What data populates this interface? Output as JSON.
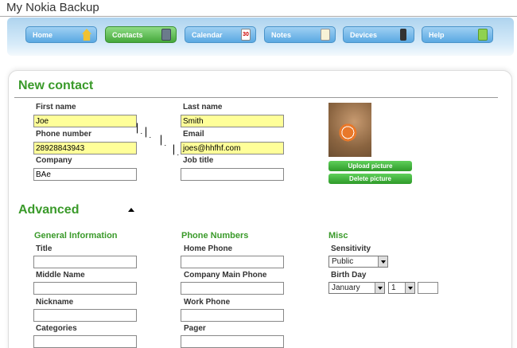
{
  "app": {
    "title": "My Nokia Backup"
  },
  "nav": {
    "tabs": [
      {
        "label": "Home",
        "icon": "home-icon"
      },
      {
        "label": "Contacts",
        "icon": "contacts-icon",
        "active": true
      },
      {
        "label": "Calendar",
        "icon": "calendar-icon",
        "badge": "30"
      },
      {
        "label": "Notes",
        "icon": "notes-icon"
      },
      {
        "label": "Devices",
        "icon": "phone-icon"
      },
      {
        "label": "Help",
        "icon": "help-book-icon"
      }
    ]
  },
  "new_contact": {
    "heading": "New contact",
    "first_name": {
      "label": "First name",
      "value": "Joe"
    },
    "last_name": {
      "label": "Last name",
      "value": "Smith"
    },
    "phone_number": {
      "label": "Phone number",
      "value": "28928843943"
    },
    "email": {
      "label": "Email",
      "value": "joes@hhfhf.com"
    },
    "company": {
      "label": "Company",
      "value": "BAe"
    },
    "job_title": {
      "label": "Job title",
      "value": ""
    },
    "upload_picture": "Upload picture",
    "delete_picture": "Delete picture"
  },
  "advanced": {
    "heading": "Advanced",
    "general": {
      "heading": "General Information",
      "title": "Title",
      "middle_name": "Middle Name",
      "nickname": "Nickname",
      "categories": "Categories"
    },
    "phones": {
      "heading": "Phone Numbers",
      "home": "Home Phone",
      "company_main": "Company Main Phone",
      "work": "Work Phone",
      "pager": "Pager"
    },
    "misc": {
      "heading": "Misc",
      "sensitivity": {
        "label": "Sensitivity",
        "value": "Public"
      },
      "birthday": {
        "label": "Birth Day",
        "month": "January",
        "day": "1",
        "year": ""
      }
    }
  },
  "colors": {
    "accent_green": "#3a9a2a",
    "highlight_yellow": "#ffff99",
    "nav_blue": "#5aa9e2"
  }
}
